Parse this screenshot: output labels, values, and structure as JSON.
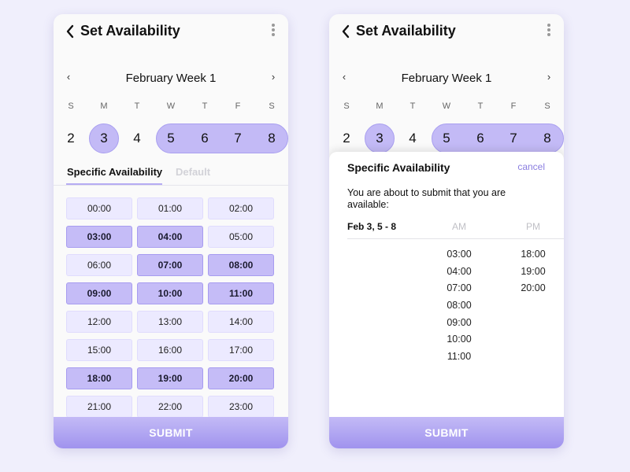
{
  "title": "Set Availability",
  "week_label": "February Week 1",
  "nav": {
    "prev": "‹",
    "next": "›"
  },
  "days_of_week": [
    "S",
    "M",
    "T",
    "W",
    "T",
    "F",
    "S"
  ],
  "dates": [
    "2",
    "3",
    "4",
    "5",
    "6",
    "7",
    "8"
  ],
  "selected_dates": [
    "3",
    "5",
    "6",
    "7",
    "8"
  ],
  "tabs": {
    "active": "Specific Availability",
    "inactive": "Default"
  },
  "time_slots": [
    {
      "label": "00:00",
      "selected": false
    },
    {
      "label": "01:00",
      "selected": false
    },
    {
      "label": "02:00",
      "selected": false
    },
    {
      "label": "03:00",
      "selected": true
    },
    {
      "label": "04:00",
      "selected": true
    },
    {
      "label": "05:00",
      "selected": false
    },
    {
      "label": "06:00",
      "selected": false
    },
    {
      "label": "07:00",
      "selected": true
    },
    {
      "label": "08:00",
      "selected": true
    },
    {
      "label": "09:00",
      "selected": true
    },
    {
      "label": "10:00",
      "selected": true
    },
    {
      "label": "11:00",
      "selected": true
    },
    {
      "label": "12:00",
      "selected": false
    },
    {
      "label": "13:00",
      "selected": false
    },
    {
      "label": "14:00",
      "selected": false
    },
    {
      "label": "15:00",
      "selected": false
    },
    {
      "label": "16:00",
      "selected": false
    },
    {
      "label": "17:00",
      "selected": false
    },
    {
      "label": "18:00",
      "selected": true
    },
    {
      "label": "19:00",
      "selected": true
    },
    {
      "label": "20:00",
      "selected": true
    },
    {
      "label": "21:00",
      "selected": false
    },
    {
      "label": "22:00",
      "selected": false
    },
    {
      "label": "23:00",
      "selected": false
    }
  ],
  "submit_label": "SUBMIT",
  "confirm_sheet": {
    "title": "Specific Availability",
    "cancel": "cancel",
    "message": "You are about to submit that you are available:",
    "date_range": "Feb 3, 5 - 8",
    "am_label": "AM",
    "pm_label": "PM",
    "am_times": [
      "03:00",
      "04:00",
      "07:00",
      "08:00",
      "09:00",
      "10:00",
      "11:00"
    ],
    "pm_times": [
      "18:00",
      "19:00",
      "20:00"
    ]
  },
  "colors": {
    "background": "#f0effc",
    "accent": "#c3baf6",
    "accent_border": "#a99ff0",
    "slot_default": "#eceaff",
    "cancel_link": "#8a7ee0"
  },
  "icons": {
    "back": "chevron-left-icon",
    "menu": "kebab-menu-icon"
  }
}
